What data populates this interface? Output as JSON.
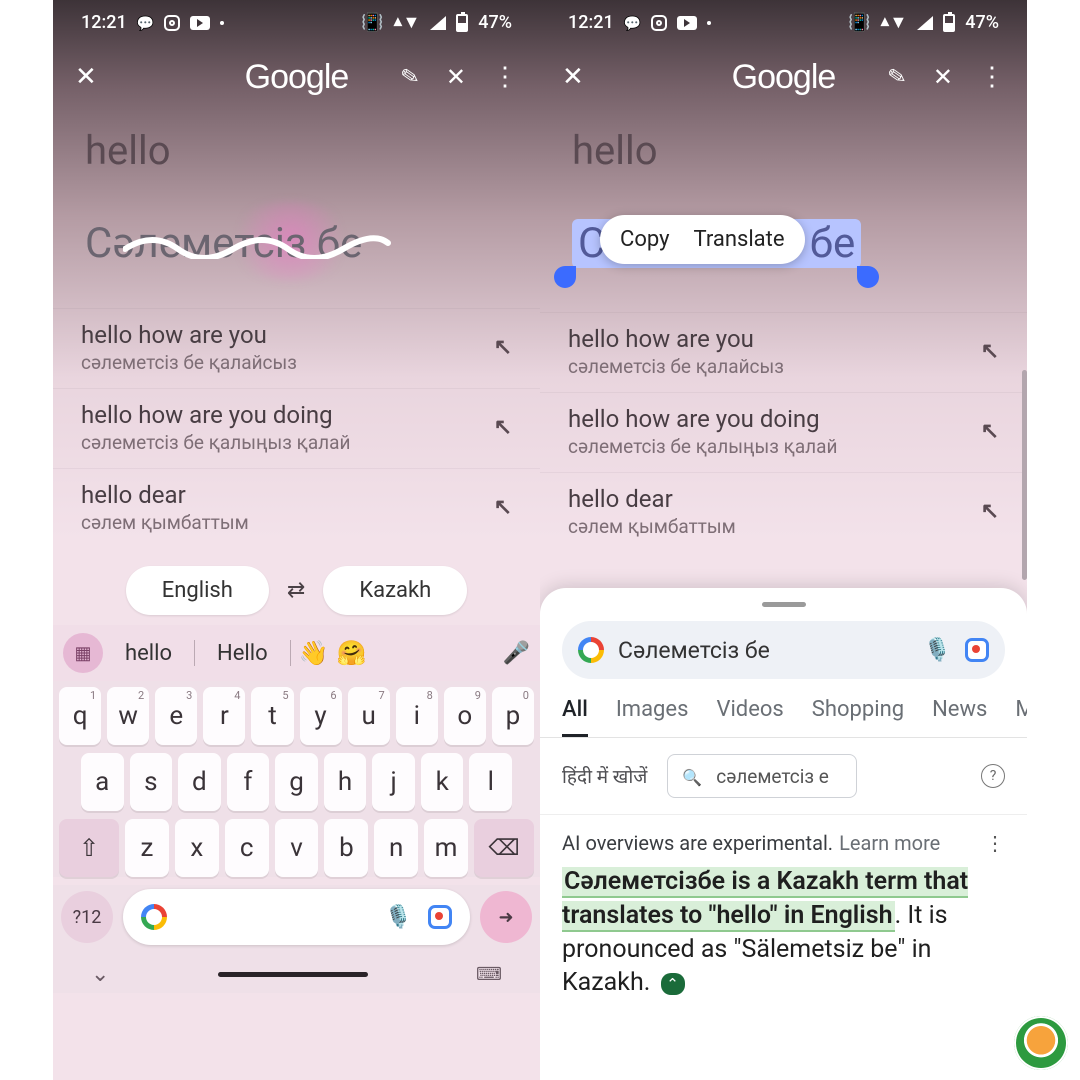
{
  "status": {
    "time": "12:21",
    "battery": "47%"
  },
  "appbar": {
    "logo": "Google"
  },
  "translate": {
    "source": "hello",
    "target": "Сәлеметсіз бе",
    "suggestions": [
      {
        "en": "hello how are you",
        "kz": "сәлеметсіз бе қалайсыз"
      },
      {
        "en": "hello how are you doing",
        "kz": "сәлеметсіз бе қалыңыз қалай"
      },
      {
        "en": "hello dear",
        "kz": "сәлем қымбаттым"
      }
    ],
    "lang_from": "English",
    "lang_to": "Kazakh"
  },
  "context_menu": {
    "copy": "Copy",
    "translate": "Translate"
  },
  "keyboard_suggestions": {
    "w1": "hello",
    "w2": "Hello",
    "e1": "👋",
    "e2": "🤗"
  },
  "keyboard": {
    "row1": [
      "q",
      "w",
      "e",
      "r",
      "t",
      "y",
      "u",
      "i",
      "o",
      "p"
    ],
    "row1_sup": [
      "1",
      "2",
      "3",
      "4",
      "5",
      "6",
      "7",
      "8",
      "9",
      "0"
    ],
    "row2": [
      "a",
      "s",
      "d",
      "f",
      "g",
      "h",
      "j",
      "k",
      "l"
    ],
    "row3": [
      "z",
      "x",
      "c",
      "v",
      "b",
      "n",
      "m"
    ],
    "sym_key": "?12"
  },
  "search": {
    "query": "Сәлеметсіз бе",
    "tabs": [
      "All",
      "Images",
      "Videos",
      "Shopping",
      "News",
      "Maps"
    ],
    "active_tab": "All",
    "hindi_hint": "हिंदी में खोजें",
    "refine_value": "сәлеметсіз е"
  },
  "ai": {
    "note_prefix": "AI overviews are experimental.",
    "note_link": "Learn more",
    "body_hl1": "Сәлеметсізбе is a Kazakh term that translates to \"hello\" in English",
    "body_rest": ". It is pronounced as \"Sälemetsiz be\" in Kazakh."
  }
}
